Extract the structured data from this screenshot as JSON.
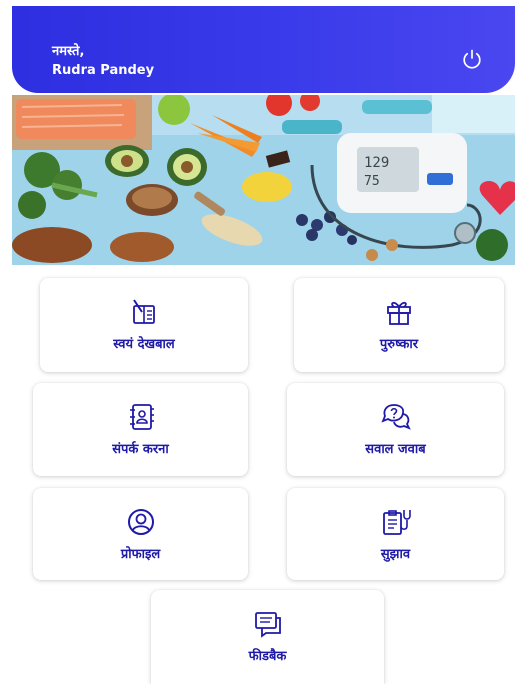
{
  "header": {
    "greeting": "नमस्ते,",
    "user_name": "Rudra Pandey",
    "power_icon": "power-icon"
  },
  "colors": {
    "header_bg": "#3433e6",
    "accent_text": "#1f1aa8",
    "icon_color": "#1f1aa8"
  },
  "menu": {
    "self_care": "स्वयं देखबाल",
    "rewards": "पुरुष्कार",
    "contact": "संपर्क करना",
    "qa": "सवाल जवाब",
    "profile": "प्रोफाइल",
    "suggestion": "सुझाव",
    "feedback": "फीडबैक"
  }
}
